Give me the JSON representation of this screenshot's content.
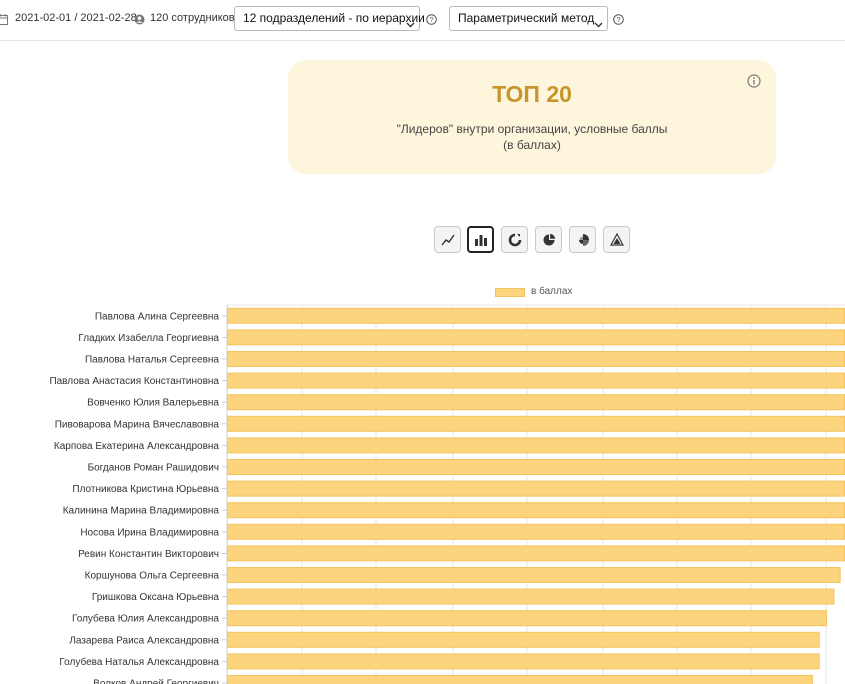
{
  "filters": {
    "calendar_icon": "calendar-icon",
    "date_range": "2021-02-01 / 2021-02-28",
    "employees_icon": "user-icon",
    "employees": "120 сотрудников",
    "departments_select": "12 подразделений - по иерархии",
    "method_select": "Параметрический метод"
  },
  "card": {
    "title": "ТОП 20",
    "subtitle_line1": "\"Лидеров\" внутри организации, условные баллы",
    "subtitle_line2": "(в баллах)",
    "title_color": "#c8952b",
    "background": "#fdf5dc"
  },
  "chart_types": [
    {
      "icon": "line-chart-icon",
      "active": false
    },
    {
      "icon": "bar-chart-icon",
      "active": true
    },
    {
      "icon": "donut-chart-icon",
      "active": false
    },
    {
      "icon": "pie-chart-icon",
      "active": false
    },
    {
      "icon": "polar-chart-icon",
      "active": false
    },
    {
      "icon": "radar-chart-icon",
      "active": false
    }
  ],
  "chart_data": {
    "type": "bar",
    "orientation": "horizontal",
    "legend": "в баллах",
    "legend_position": "top",
    "bar_color": "#fbd47d",
    "bar_border_color": "#f3c45e",
    "grid": true,
    "xlim": [
      0,
      100
    ],
    "categories": [
      "Павлова Алина Сергеевна",
      "Гладких Изабелла Георгиевна",
      "Павлова Наталья Сергеевна",
      "Павлова Анастасия Константиновна",
      "Вовченко Юлия Валерьевна",
      "Пивоварова Марина Вячеславовна",
      "Карпова Екатерина Александровна",
      "Богданов Роман Рашидович",
      "Плотникова Кристина Юрьевна",
      "Калинина Марина Владимировна",
      "Носова Ирина Владимировна",
      "Ревин Константин Викторович",
      "Коршунова Ольга Сергеевна",
      "Гришкова Оксана Юрьевна",
      "Голубева Юлия Александровна",
      "Лазарева Раиса Александровна",
      "Голубева Наталья Александровна",
      "Волков Андрей Георгиевич"
    ],
    "values": [
      100,
      100,
      100,
      100,
      100,
      100,
      100,
      100,
      100,
      100,
      100,
      100,
      99.3,
      98.3,
      97.1,
      95.9,
      95.9,
      94.8
    ]
  }
}
